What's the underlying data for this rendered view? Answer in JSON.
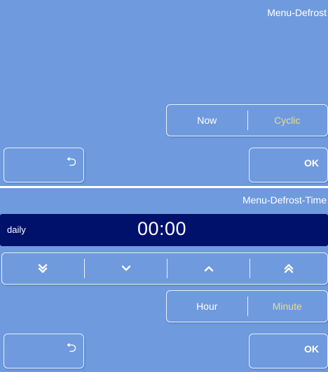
{
  "colors": {
    "background": "#6f9ade",
    "accent": "#e3e08a",
    "time_bar": "#00116b"
  },
  "defrost_menu": {
    "title": "Menu-Defrost",
    "now_label": "Now",
    "cyclic_label": "Cyclic",
    "ok_label": "OK",
    "back_icon": "return-icon"
  },
  "defrost_time_menu": {
    "title": "Menu-Defrost-Time",
    "mode": "daily",
    "time": "00:00",
    "arrows": [
      "double-down-icon",
      "down-icon",
      "up-icon",
      "double-up-icon"
    ],
    "hour_label": "Hour",
    "minute_label": "Minute",
    "ok_label": "OK",
    "back_icon": "return-icon"
  }
}
